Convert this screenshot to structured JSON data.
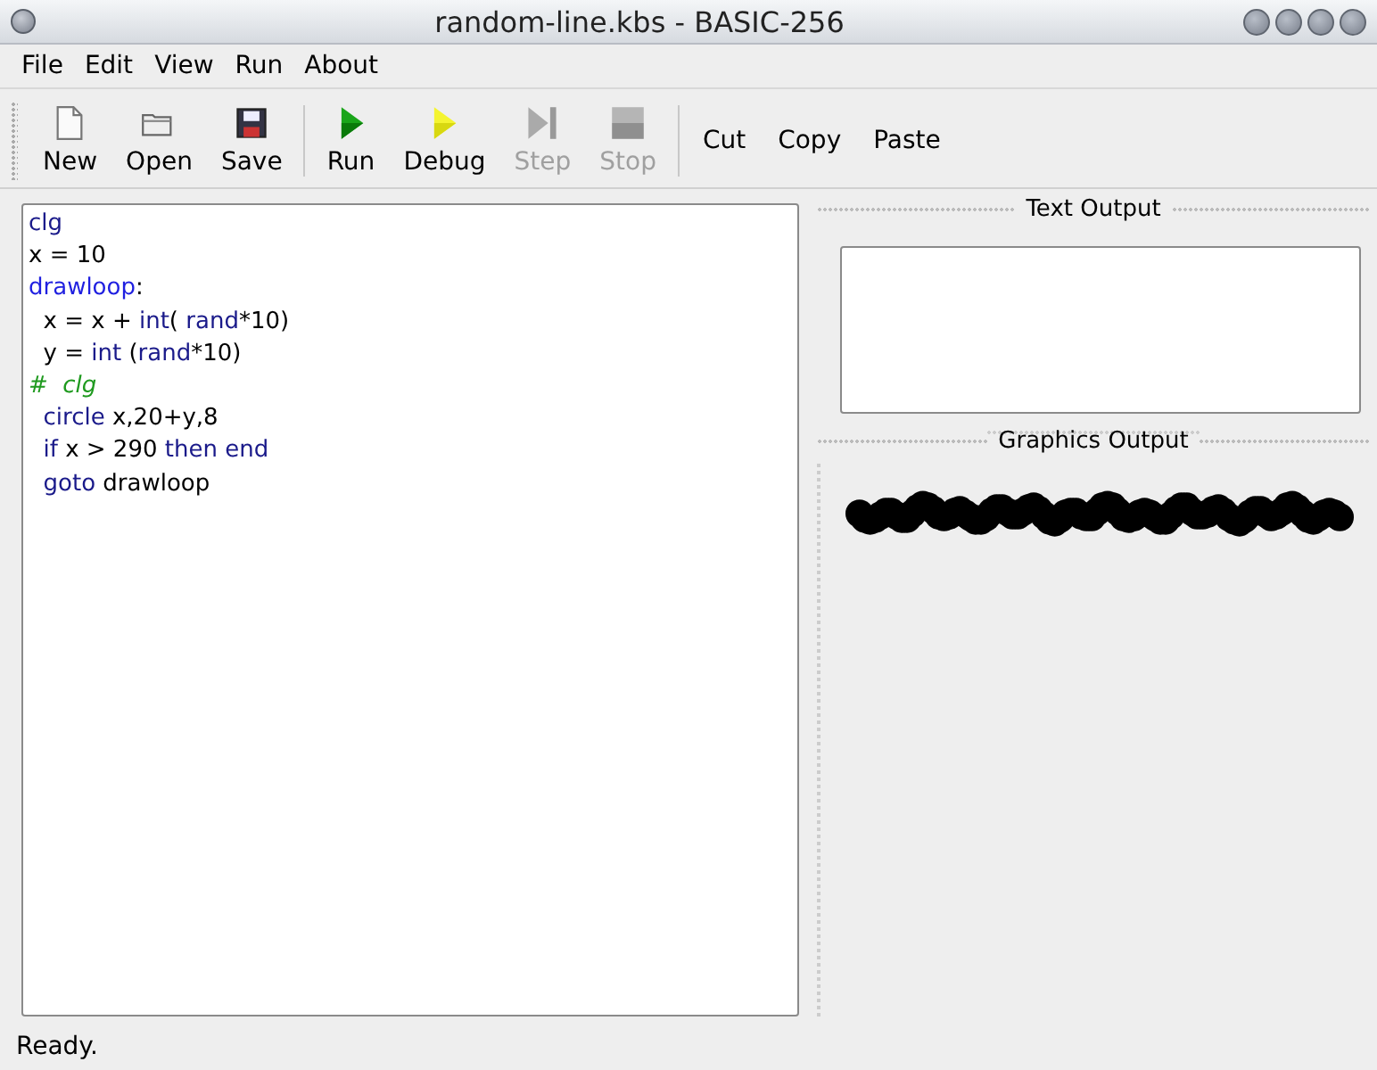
{
  "window": {
    "title": "random-line.kbs - BASIC-256"
  },
  "menu": [
    "File",
    "Edit",
    "View",
    "Run",
    "About"
  ],
  "toolbar": [
    {
      "kind": "new",
      "label": "New",
      "disabled": false
    },
    {
      "kind": "open",
      "label": "Open",
      "disabled": false
    },
    {
      "kind": "save",
      "label": "Save",
      "disabled": false
    },
    {
      "kind": "run",
      "label": "Run",
      "disabled": false
    },
    {
      "kind": "debug",
      "label": "Debug",
      "disabled": false
    },
    {
      "kind": "step",
      "label": "Step",
      "disabled": true
    },
    {
      "kind": "stop",
      "label": "Stop",
      "disabled": true
    },
    {
      "kind": "text",
      "label": "Cut",
      "disabled": false
    },
    {
      "kind": "text",
      "label": "Copy",
      "disabled": false
    },
    {
      "kind": "text",
      "label": "Paste",
      "disabled": false
    }
  ],
  "editor": {
    "lines": [
      [
        {
          "text": "clg",
          "kind": "keyword"
        }
      ],
      [
        {
          "text": "x = 10",
          "kind": "plain"
        }
      ],
      [
        {
          "text": "drawloop",
          "kind": "label"
        },
        {
          "text": ":",
          "kind": "plain"
        }
      ],
      [
        {
          "text": "  x = x + ",
          "kind": "plain"
        },
        {
          "text": "int",
          "kind": "keyword"
        },
        {
          "text": "( ",
          "kind": "plain"
        },
        {
          "text": "rand",
          "kind": "keyword"
        },
        {
          "text": "*10)",
          "kind": "plain"
        }
      ],
      [
        {
          "text": "  y = ",
          "kind": "plain"
        },
        {
          "text": "int",
          "kind": "keyword"
        },
        {
          "text": " (",
          "kind": "plain"
        },
        {
          "text": "rand",
          "kind": "keyword"
        },
        {
          "text": "*10)",
          "kind": "plain"
        }
      ],
      [
        {
          "text": "#  clg",
          "kind": "comment"
        }
      ],
      [
        {
          "text": "  circle",
          "kind": "keyword"
        },
        {
          "text": " x,20+y,8",
          "kind": "plain"
        }
      ],
      [
        {
          "text": "  if",
          "kind": "keyword"
        },
        {
          "text": " x > 290 ",
          "kind": "plain"
        },
        {
          "text": "then end",
          "kind": "keyword"
        }
      ],
      [
        {
          "text": "  goto",
          "kind": "keyword"
        },
        {
          "text": " drawloop",
          "kind": "plain"
        }
      ]
    ]
  },
  "text_output": {
    "title": "Text Output"
  },
  "graphics_output": {
    "title": "Graphics Output"
  },
  "status_bar": "Ready."
}
